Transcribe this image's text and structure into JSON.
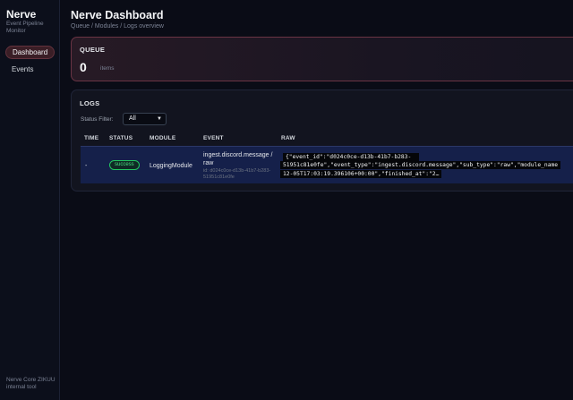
{
  "sidebar": {
    "brand_title": "Nerve",
    "brand_subtitle": "Event Pipeline Monitor",
    "items": [
      {
        "label": "Dashboard",
        "active": true
      },
      {
        "label": "Events",
        "active": false
      }
    ],
    "footer": "Nerve Core ZIKUU internal tool"
  },
  "header": {
    "title": "Nerve Dashboard",
    "breadcrumb": "Queue / Modules / Logs overview"
  },
  "queue": {
    "label": "QUEUE",
    "count": "0",
    "unit": "items"
  },
  "logs": {
    "label": "LOGS",
    "filter_label": "Status Filter:",
    "filter_value": "All",
    "columns": [
      "TIME",
      "STATUS",
      "MODULE",
      "EVENT",
      "RAW"
    ],
    "rows": [
      {
        "time": "-",
        "status": "success",
        "module": "LoggingModule",
        "event": "ingest.discord.message / raw",
        "event_id": "id: d024c0ce-d13b-41b7-b283-51951c81e0fe",
        "raw_lines": [
          "{\"event_id\":\"d024c0ce-d13b-41b7-b283-",
          "51951c81e0fe\",\"event_type\":\"ingest.discord.message\",\"sub_type\":\"raw\",\"module_name",
          "12-05T17:03:19.396106+00:00\",\"finished_at\":\"2…"
        ]
      }
    ]
  },
  "colors": {
    "background": "#0a0c16",
    "accent_border": "#6a3444",
    "row_highlight": "#15204a",
    "success": "#22c55e"
  }
}
